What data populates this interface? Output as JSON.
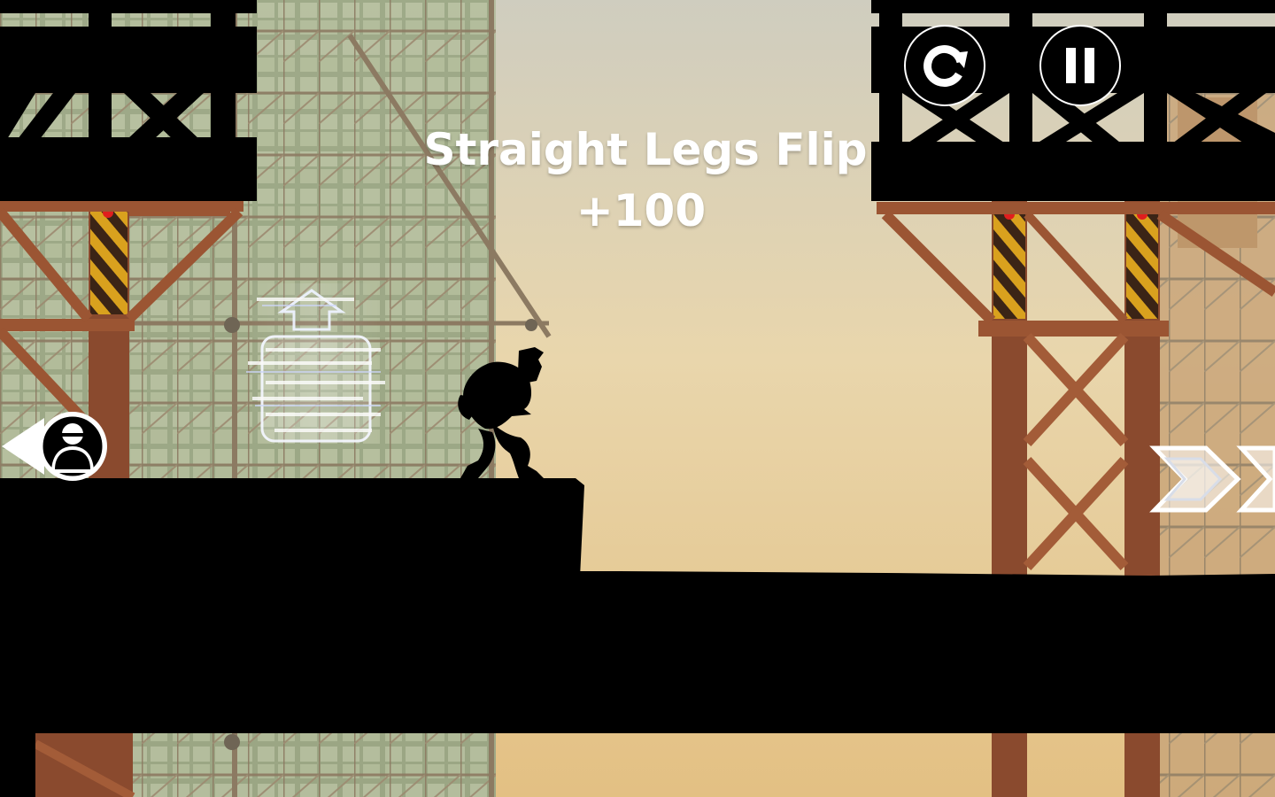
{
  "hud": {
    "restart_icon": "restart-icon",
    "pause_icon": "pause-icon"
  },
  "trick": {
    "name": "Straight Legs Flip",
    "points": "+100"
  },
  "indicators": {
    "hunter_icon": "hunter-silhouette-icon",
    "direction_icon": "forward-chevrons-icon"
  },
  "colors": {
    "sky_top": "#c9c7b8",
    "sky_mid": "#e8d2a6",
    "sky_bottom": "#e6c489",
    "girder": "#8a4a2e",
    "girder_light": "#b0653c",
    "hazard_yellow": "#d9a11e",
    "silhouette": "#000000",
    "window_glass": "#a3b08c",
    "text": "#ffffff"
  }
}
